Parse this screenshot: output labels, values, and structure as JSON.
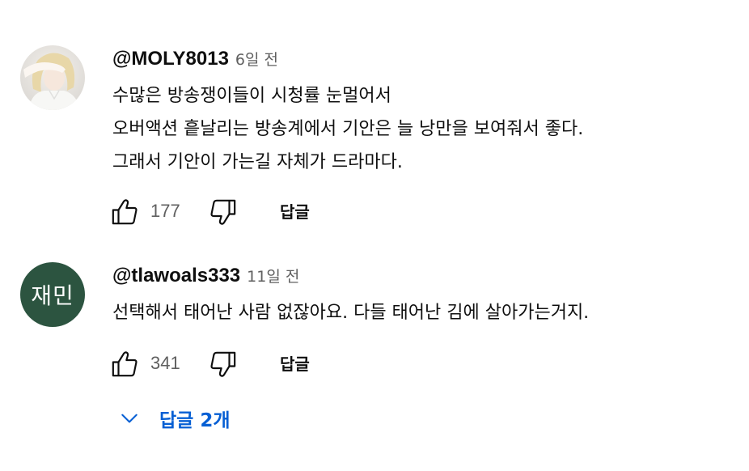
{
  "comments": [
    {
      "author": "@MOLY8013",
      "time": "6일 전",
      "avatar": "photo-avatar",
      "lines": [
        "수많은 방송쟁이들이 시청률 눈멀어서",
        "오버액션 흩날리는 방송계에서 기안은 늘 낭만을 보여줘서 좋다.",
        "그래서 기안이 가는길 자체가 드라마다."
      ],
      "likes": "177",
      "reply_label": "답글"
    },
    {
      "author": "@tlawoals333",
      "time": "11일 전",
      "avatar_initials": "재민",
      "avatar_color": "#2c5440",
      "lines": [
        "선택해서 태어난 사람 없잖아요. 다들 태어난 김에 살아가는거지."
      ],
      "likes": "341",
      "reply_label": "답글",
      "replies_toggle": "답글 2개"
    }
  ],
  "colors": {
    "accent": "#065fd4",
    "text": "#0f0f0f",
    "secondary": "#606060"
  },
  "icons": [
    "thumbs-up-icon",
    "thumbs-down-icon",
    "chevron-down-icon"
  ]
}
